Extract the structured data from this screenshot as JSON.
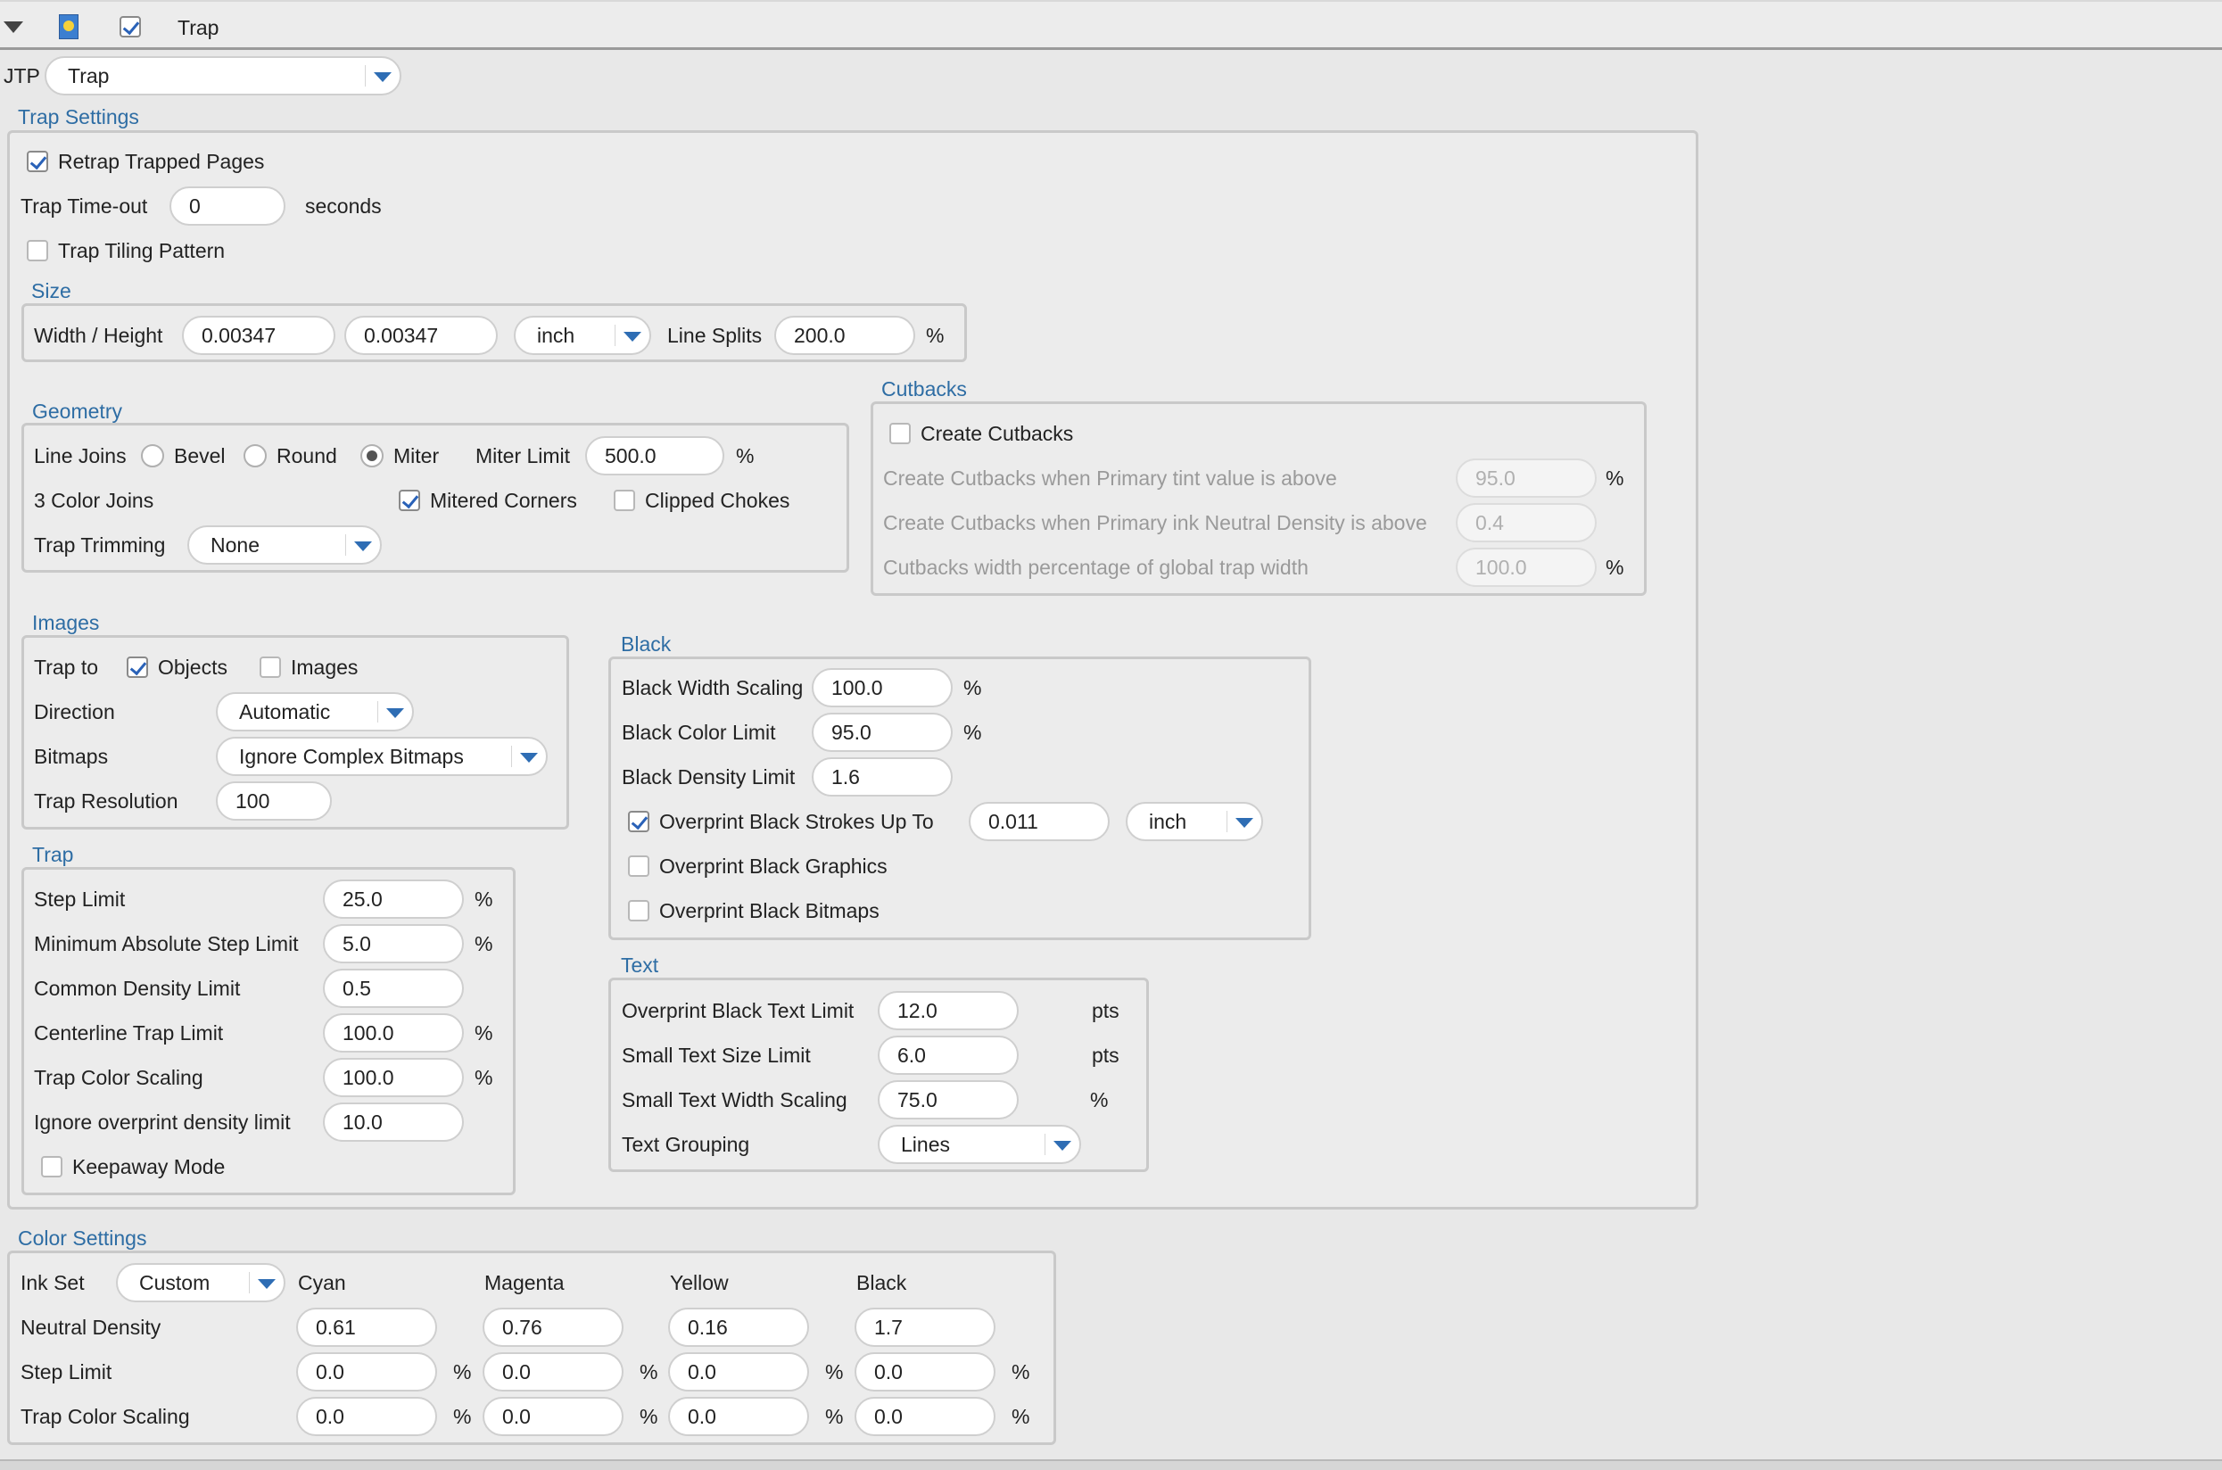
{
  "header": {
    "title": "Trap"
  },
  "jtp": {
    "label": "JTP",
    "value": "Trap"
  },
  "trap_settings": {
    "title": "Trap Settings",
    "retrap_label": "Retrap Trapped Pages",
    "retrap_checked": true,
    "timeout_label": "Trap Time-out",
    "timeout_value": "0",
    "timeout_unit": "seconds",
    "tiling_label": "Trap Tiling Pattern",
    "tiling_checked": false
  },
  "size": {
    "title": "Size",
    "wh_label": "Width / Height",
    "width": "0.00347",
    "height": "0.00347",
    "unit": "inch",
    "line_splits_label": "Line Splits",
    "line_splits": "200.0",
    "percent": "%"
  },
  "geometry": {
    "title": "Geometry",
    "line_joins_label": "Line Joins",
    "bevel": "Bevel",
    "round": "Round",
    "miter": "Miter",
    "selected_join": "Miter",
    "miter_limit_label": "Miter Limit",
    "miter_limit": "500.0",
    "percent": "%",
    "color_joins_label": "3 Color Joins",
    "mitered_corners": "Mitered Corners",
    "mitered_checked": true,
    "clipped_chokes": "Clipped Chokes",
    "clipped_checked": false,
    "trimming_label": "Trap Trimming",
    "trimming_value": "None"
  },
  "cutbacks": {
    "title": "Cutbacks",
    "create_label": "Create Cutbacks",
    "create_checked": false,
    "tint_label": "Create Cutbacks when Primary tint value is above",
    "tint_value": "95.0",
    "density_label": "Create Cutbacks when Primary ink Neutral Density is above",
    "density_value": "0.4",
    "width_label": "Cutbacks width percentage of global trap width",
    "width_value": "100.0",
    "percent": "%"
  },
  "images": {
    "title": "Images",
    "trap_to_label": "Trap to",
    "objects": "Objects",
    "objects_checked": true,
    "images": "Images",
    "images_checked": false,
    "direction_label": "Direction",
    "direction_value": "Automatic",
    "bitmaps_label": "Bitmaps",
    "bitmaps_value": "Ignore Complex Bitmaps",
    "resolution_label": "Trap Resolution",
    "resolution_value": "100"
  },
  "trap": {
    "title": "Trap",
    "percent": "%",
    "step_limit_label": "Step Limit",
    "step_limit": "25.0",
    "min_step_label": "Minimum Absolute Step Limit",
    "min_step": "5.0",
    "common_density_label": "Common Density Limit",
    "common_density": "0.5",
    "centerline_label": "Centerline Trap Limit",
    "centerline": "100.0",
    "color_scaling_label": "Trap Color Scaling",
    "color_scaling": "100.0",
    "ignore_overprint_label": "Ignore overprint density limit",
    "ignore_overprint": "10.0",
    "keepaway_label": "Keepaway Mode",
    "keepaway_checked": false
  },
  "black": {
    "title": "Black",
    "percent": "%",
    "width_scaling_label": "Black Width Scaling",
    "width_scaling": "100.0",
    "color_limit_label": "Black Color Limit",
    "color_limit": "95.0",
    "density_limit_label": "Black Density Limit",
    "density_limit": "1.6",
    "strokes_label": "Overprint Black Strokes Up To",
    "strokes_checked": true,
    "strokes_value": "0.011",
    "strokes_unit": "inch",
    "graphics_label": "Overprint Black Graphics",
    "graphics_checked": false,
    "bitmaps_label": "Overprint Black Bitmaps",
    "bitmaps_checked": false
  },
  "text": {
    "title": "Text",
    "pts": "pts",
    "percent": "%",
    "overprint_label": "Overprint Black Text Limit",
    "overprint": "12.0",
    "small_size_label": "Small Text Size Limit",
    "small_size": "6.0",
    "small_width_label": "Small Text Width Scaling",
    "small_width": "75.0",
    "grouping_label": "Text Grouping",
    "grouping": "Lines"
  },
  "color_settings": {
    "title": "Color Settings",
    "ink_set_label": "Ink Set",
    "ink_set_value": "Custom",
    "percent": "%",
    "inks": [
      "Cyan",
      "Magenta",
      "Yellow",
      "Black"
    ],
    "rows": [
      {
        "label": "Neutral Density",
        "values": [
          "0.61",
          "0.76",
          "0.16",
          "1.7"
        ],
        "unit": ""
      },
      {
        "label": "Step Limit",
        "values": [
          "0.0",
          "0.0",
          "0.0",
          "0.0"
        ],
        "unit": "%"
      },
      {
        "label": "Trap Color Scaling",
        "values": [
          "0.0",
          "0.0",
          "0.0",
          "0.0"
        ],
        "unit": "%"
      }
    ]
  }
}
